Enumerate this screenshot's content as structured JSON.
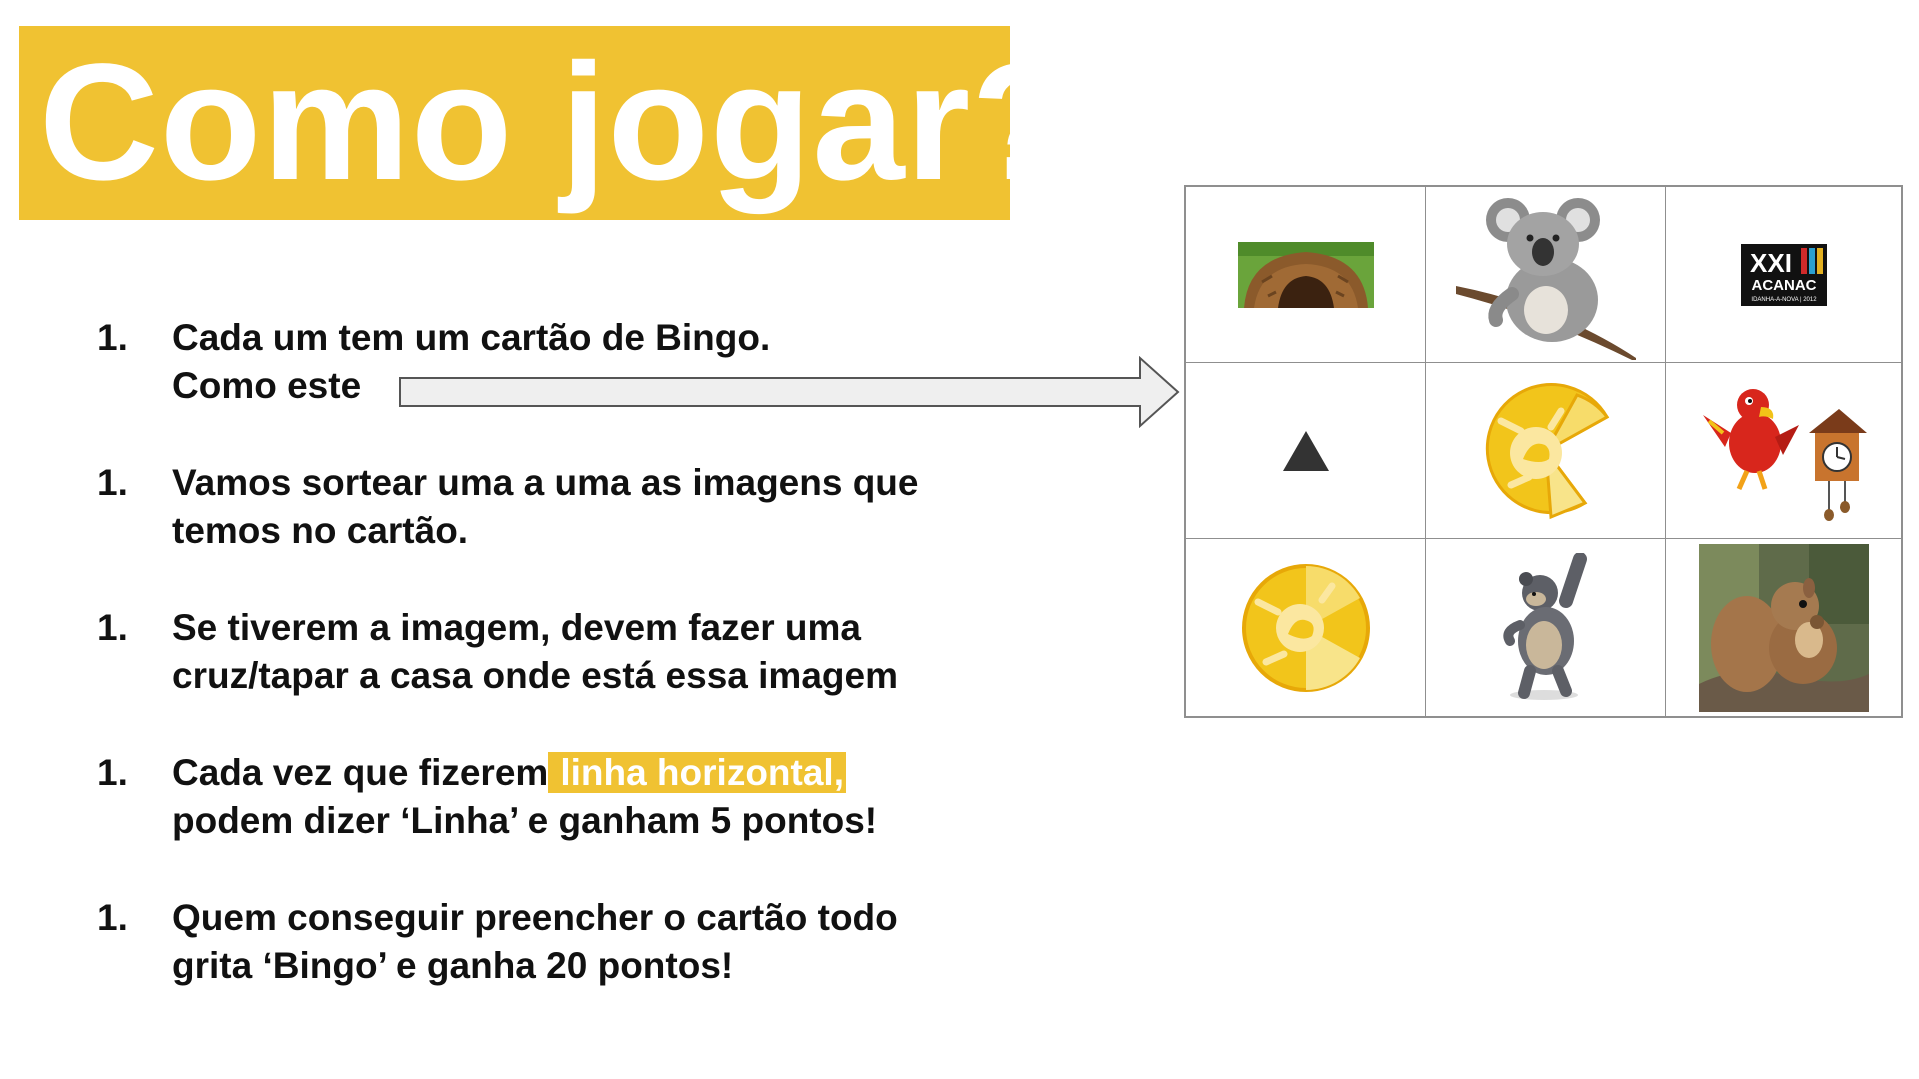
{
  "title": "Como jogar?",
  "steps": [
    {
      "number": "1.",
      "line1": "Cada um tem um cartão de Bingo.",
      "line2": "Como este"
    },
    {
      "number": "1.",
      "line1": "Vamos sortear uma a uma as imagens que",
      "line2": "temos no cartão."
    },
    {
      "number": "1.",
      "line1": "Se tiverem a imagem, devem fazer uma",
      "line2": "cruz/tapar a casa onde está essa imagem"
    },
    {
      "number": "1.",
      "line1_before": "Cada vez que fizerem",
      "line1_highlight": "linha horizontal,",
      "line2": "podem dizer ‘Linha’ e ganham 5 pontos!"
    },
    {
      "number": "1.",
      "line1": "Quem conseguir preencher o cartão todo",
      "line2": "grita ‘Bingo’ e ganha 20 pontos!"
    }
  ],
  "bingo_card": {
    "cells": [
      {
        "icon": "burrow-icon"
      },
      {
        "icon": "koala-icon"
      },
      {
        "icon": "acanac-logo",
        "logo_line1": "XXI",
        "logo_line2": "ACANAC",
        "logo_line3": "IDANHA-A-NOVA | 2012"
      },
      {
        "icon": "triangle-icon"
      },
      {
        "icon": "yellow-badge-open-icon"
      },
      {
        "icon": "parrot-cuckoo-clock-icon"
      },
      {
        "icon": "yellow-badge-icon"
      },
      {
        "icon": "bear-icon"
      },
      {
        "icon": "squirrel-icon"
      }
    ]
  },
  "colors": {
    "accent": "#f0c232",
    "text": "#111111",
    "grid": "#8f8f8f"
  }
}
